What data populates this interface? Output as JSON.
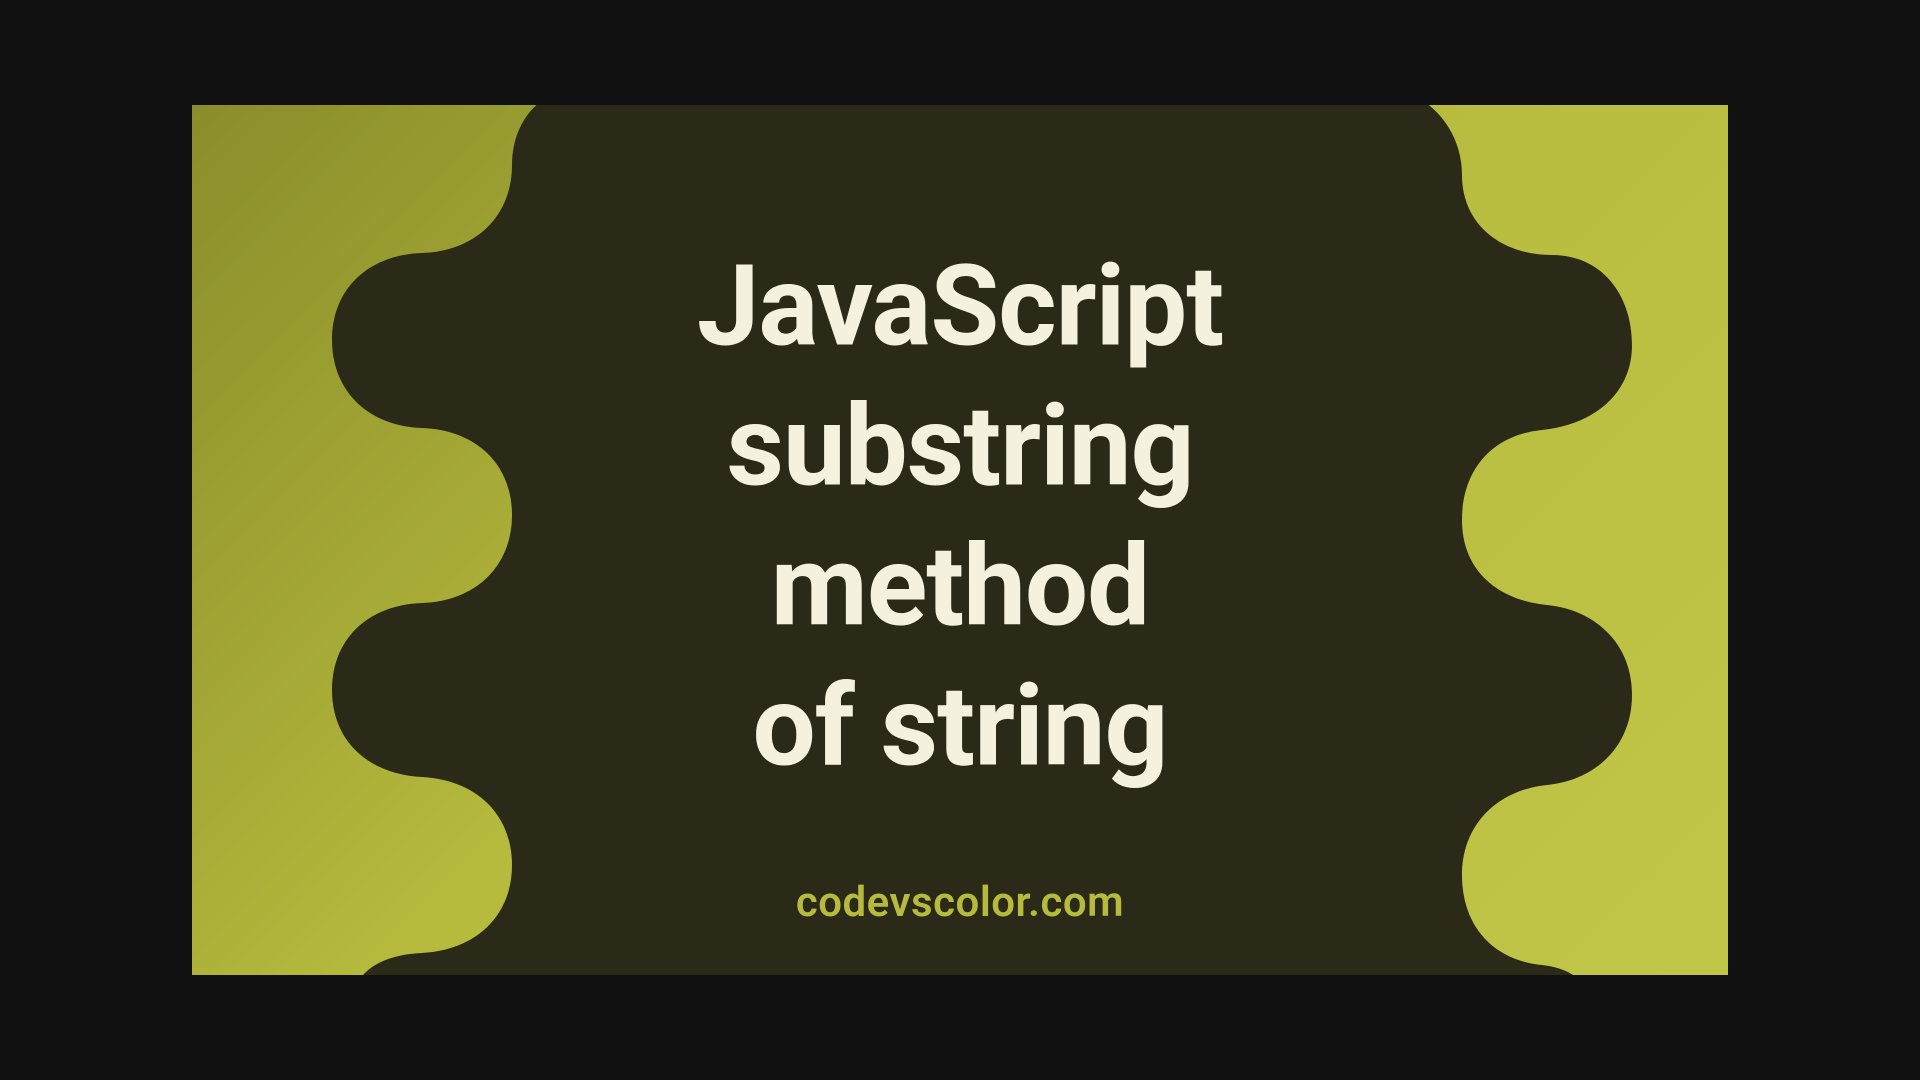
{
  "title": {
    "line1": "JavaScript",
    "line2": "substring",
    "line3": "method",
    "line4": "of string"
  },
  "attribution": "codevscolor.com",
  "colors": {
    "bg_olive_light": "#c2c648",
    "bg_olive_dark": "#8a8d2a",
    "blob_dark": "#2b2a18",
    "text_cream": "#f4f2df",
    "attribution_olive": "#b7bb3d"
  }
}
